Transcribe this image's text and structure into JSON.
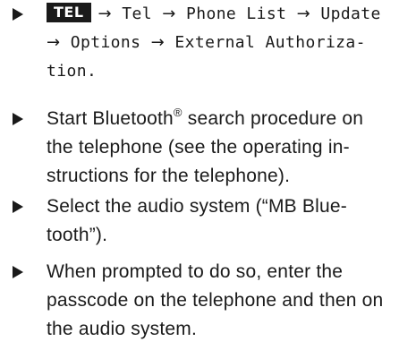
{
  "steps": [
    {
      "key_label": "TEL",
      "path": [
        "Tel",
        "Phone List",
        "Update",
        "Options",
        "External Authoriza-",
        "tion"
      ],
      "arrow": "→",
      "terminal": "."
    },
    {
      "before_mark": "Start Bluetooth",
      "mark": "®",
      "after_mark_line1": " search procedure on",
      "line2": "the telephone (see the operating in-",
      "line3": "structions for the telephone)."
    },
    {
      "line1": "Select the audio system (“MB Blue-",
      "line2": "tooth”)."
    },
    {
      "line1": "When prompted to do so, enter the",
      "line2": "passcode on the telephone and then on",
      "line3": "the audio system."
    }
  ]
}
